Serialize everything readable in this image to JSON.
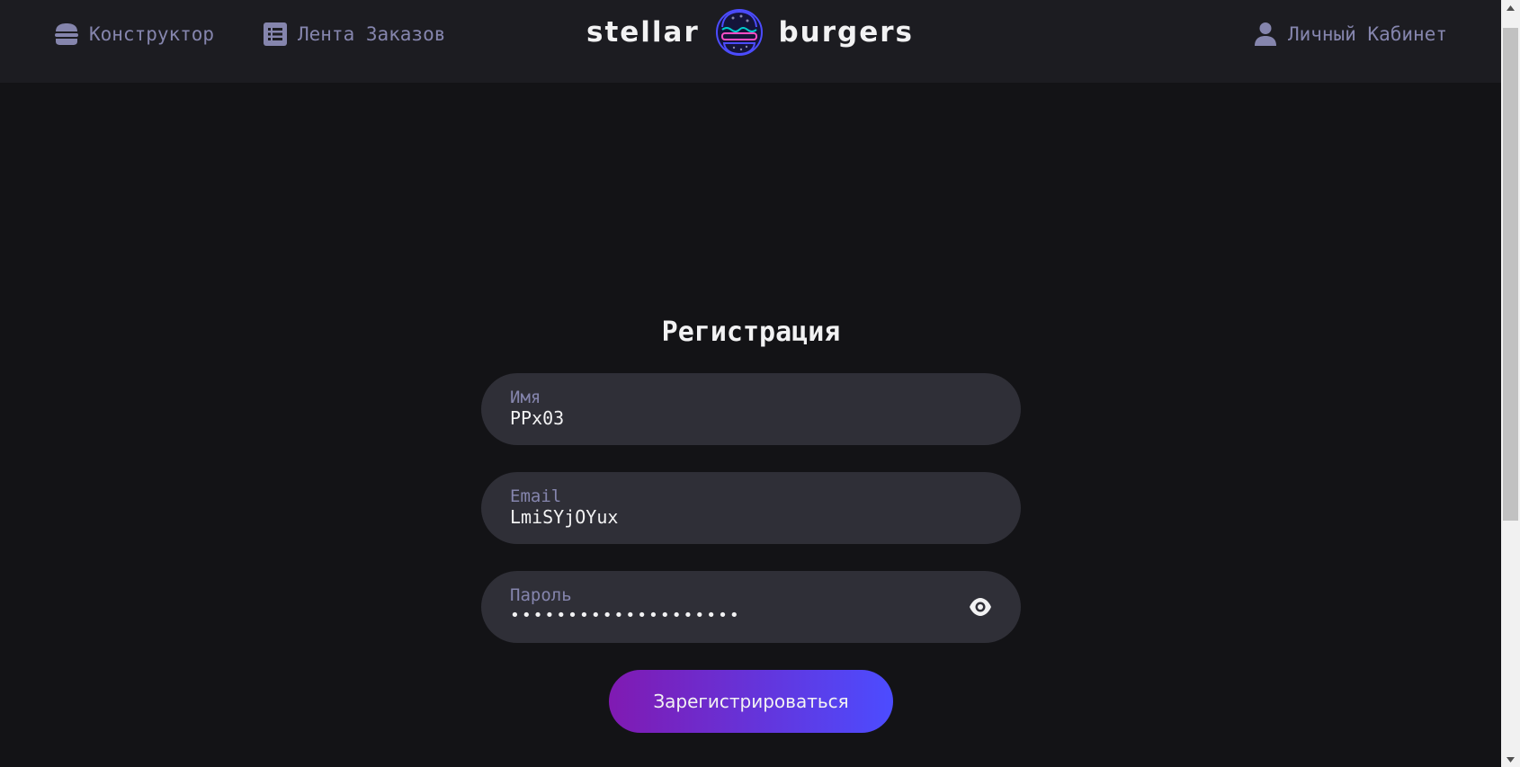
{
  "header": {
    "nav": {
      "constructor_label": "Конструктор",
      "feed_label": "Лента Заказов",
      "profile_label": "Личный Кабинет"
    },
    "logo": {
      "left_text": "stellar",
      "right_text": "burgers"
    }
  },
  "register_form": {
    "title": "Регистрация",
    "name_field": {
      "label": "Имя",
      "value": "PPx03"
    },
    "email_field": {
      "label": "Email",
      "value": "LmiSYjOYux"
    },
    "password_field": {
      "label": "Пароль",
      "value": "••••••••••••••••••••"
    },
    "submit_label": "Зарегистрироваться"
  },
  "colors": {
    "background": "#131316",
    "header_bg": "#1c1c21",
    "input_bg": "#2f2f37",
    "nav_text": "#8585ad",
    "text_primary": "#f2f2f3",
    "button_gradient_start": "#801ab2",
    "button_gradient_end": "#4c4cff"
  },
  "icons": {
    "constructor": "burger-icon",
    "feed": "list-icon",
    "profile": "user-icon",
    "password_toggle": "eye-icon"
  }
}
